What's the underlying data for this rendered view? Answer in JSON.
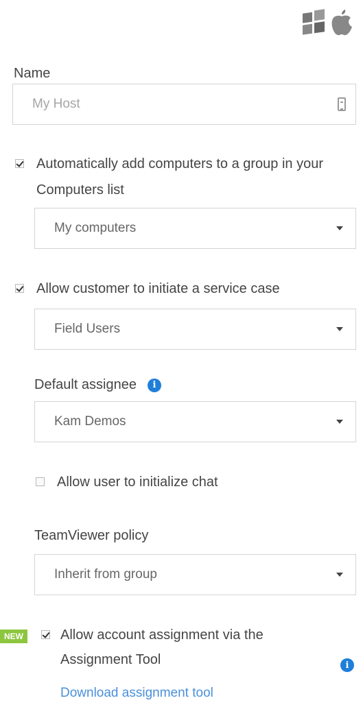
{
  "icons": {
    "windows": "windows-icon",
    "apple": "apple-icon",
    "info": "info-icon",
    "paste": "clipboard-icon"
  },
  "name_field": {
    "label": "Name",
    "placeholder": "My Host"
  },
  "auto_add_group": {
    "checked": true,
    "label": "Automatically add computers to a group in your Computers list",
    "select_value": "My computers"
  },
  "service_case": {
    "checked": true,
    "label": "Allow customer to initiate a service case",
    "select_value": "Field Users",
    "default_assignee_label": "Default assignee",
    "assignee_value": "Kam Demos",
    "allow_chat": {
      "checked": false,
      "label": "Allow user to initialize chat"
    }
  },
  "policy": {
    "label": "TeamViewer policy",
    "select_value": "Inherit from group"
  },
  "assignment": {
    "badge": "NEW",
    "checked": true,
    "label": "Allow account assignment via the Assignment Tool",
    "link": "Download assignment tool"
  },
  "colors": {
    "accent_blue": "#1f7fd8",
    "link_blue": "#4a90d9",
    "new_badge_green": "#8cc63f",
    "border_gray": "#d4d4d4"
  }
}
